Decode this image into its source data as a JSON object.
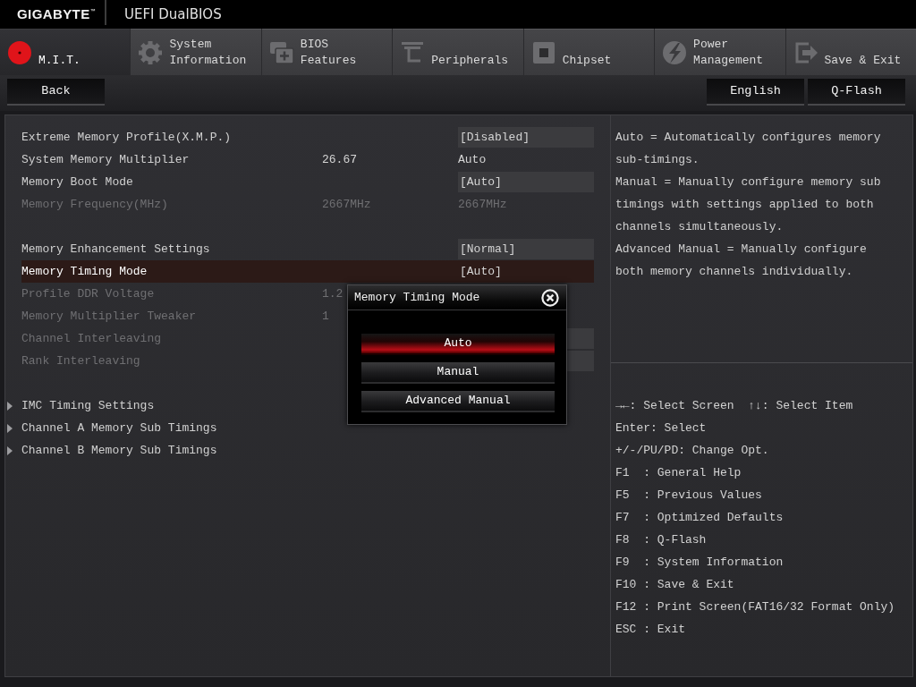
{
  "header": {
    "brand": "GIGABYTE$^{™}$",
    "title": "UEFI DualBIOS"
  },
  "tabs": [
    {
      "label": "M.I.T.",
      "selected": true
    },
    {
      "label": "System Information",
      "selected": false
    },
    {
      "label": "BIOS Features",
      "selected": false
    },
    {
      "label": "Peripherals",
      "selected": false
    },
    {
      "label": "Chipset",
      "selected": false
    },
    {
      "label": "Power Management",
      "selected": false
    },
    {
      "label": "Save & Exit",
      "selected": false
    }
  ],
  "toolbar": {
    "left_buttons": [
      "Back"
    ],
    "right_buttons": [
      "English",
      "Q-Flash"
    ]
  },
  "settings": [
    {
      "kind": "setting",
      "label": "Extreme Memory Profile(X.M.P.)",
      "option": "[Disabled]",
      "boxed": true,
      "disabled": false,
      "selected": false
    },
    {
      "kind": "setting",
      "label": "System Memory Multiplier",
      "value": "26.67",
      "option": "Auto",
      "boxed": false,
      "disabled": false,
      "selected": false
    },
    {
      "kind": "setting",
      "label": "Memory Boot Mode",
      "option": "[Auto]",
      "boxed": true,
      "disabled": false,
      "selected": false
    },
    {
      "kind": "setting",
      "label": "Memory Frequency(MHz)",
      "value": "2667MHz",
      "option": "2667MHz",
      "boxed": false,
      "disabled": true,
      "selected": false
    },
    {
      "kind": "spacer"
    },
    {
      "kind": "setting",
      "label": "Memory Enhancement Settings",
      "option": "[Normal]",
      "boxed": true,
      "disabled": false,
      "selected": false
    },
    {
      "kind": "setting",
      "label": "Memory Timing Mode",
      "option": "[Auto]",
      "boxed": true,
      "disabled": false,
      "selected": true
    },
    {
      "kind": "setting",
      "label": "Profile DDR Voltage",
      "value": "1.2",
      "disabled": true,
      "selected": false
    },
    {
      "kind": "setting",
      "label": "Memory Multiplier Tweaker",
      "value": "1",
      "disabled": true,
      "selected": false
    },
    {
      "kind": "setting",
      "label": "Channel Interleaving",
      "boxed": true,
      "disabled": true,
      "selected": false
    },
    {
      "kind": "setting",
      "label": "Rank Interleaving",
      "boxed": true,
      "disabled": true,
      "selected": false
    },
    {
      "kind": "spacer"
    },
    {
      "kind": "submenu",
      "label": "IMC Timing Settings",
      "disabled": false,
      "selected": false
    },
    {
      "kind": "submenu",
      "label": "Channel A Memory Sub Timings",
      "disabled": false,
      "selected": false
    },
    {
      "kind": "submenu",
      "label": "Channel B Memory Sub Timings",
      "disabled": false,
      "selected": false
    }
  ],
  "popup": {
    "title": "Memory Timing Mode",
    "options": [
      {
        "label": "Auto",
        "selected": true
      },
      {
        "label": "Manual",
        "selected": false
      },
      {
        "label": "Advanced Manual",
        "selected": false
      }
    ]
  },
  "help_text": [
    "Auto = Automatically configures memory sub-timings.",
    "Manual = Manually configure memory sub timings with settings applied to both channels simultaneously.",
    "Advanced Manual = Manually configure both memory channels individually."
  ],
  "key_legend": [
    [
      "→←: Select Screen",
      "↑↓: Select Item"
    ],
    [
      "Enter: Select"
    ],
    [
      "+/-/PU/PD: Change Opt."
    ],
    [
      "F1  : General Help"
    ],
    [
      "F5  : Previous Values"
    ],
    [
      "F7  : Optimized Defaults"
    ],
    [
      "F8  : Q-Flash"
    ],
    [
      "F9  : System Information"
    ],
    [
      "F10 : Save & Exit"
    ],
    [
      "F12 : Print Screen(FAT16/32 Format Only)"
    ],
    [
      "ESC : Exit"
    ]
  ]
}
